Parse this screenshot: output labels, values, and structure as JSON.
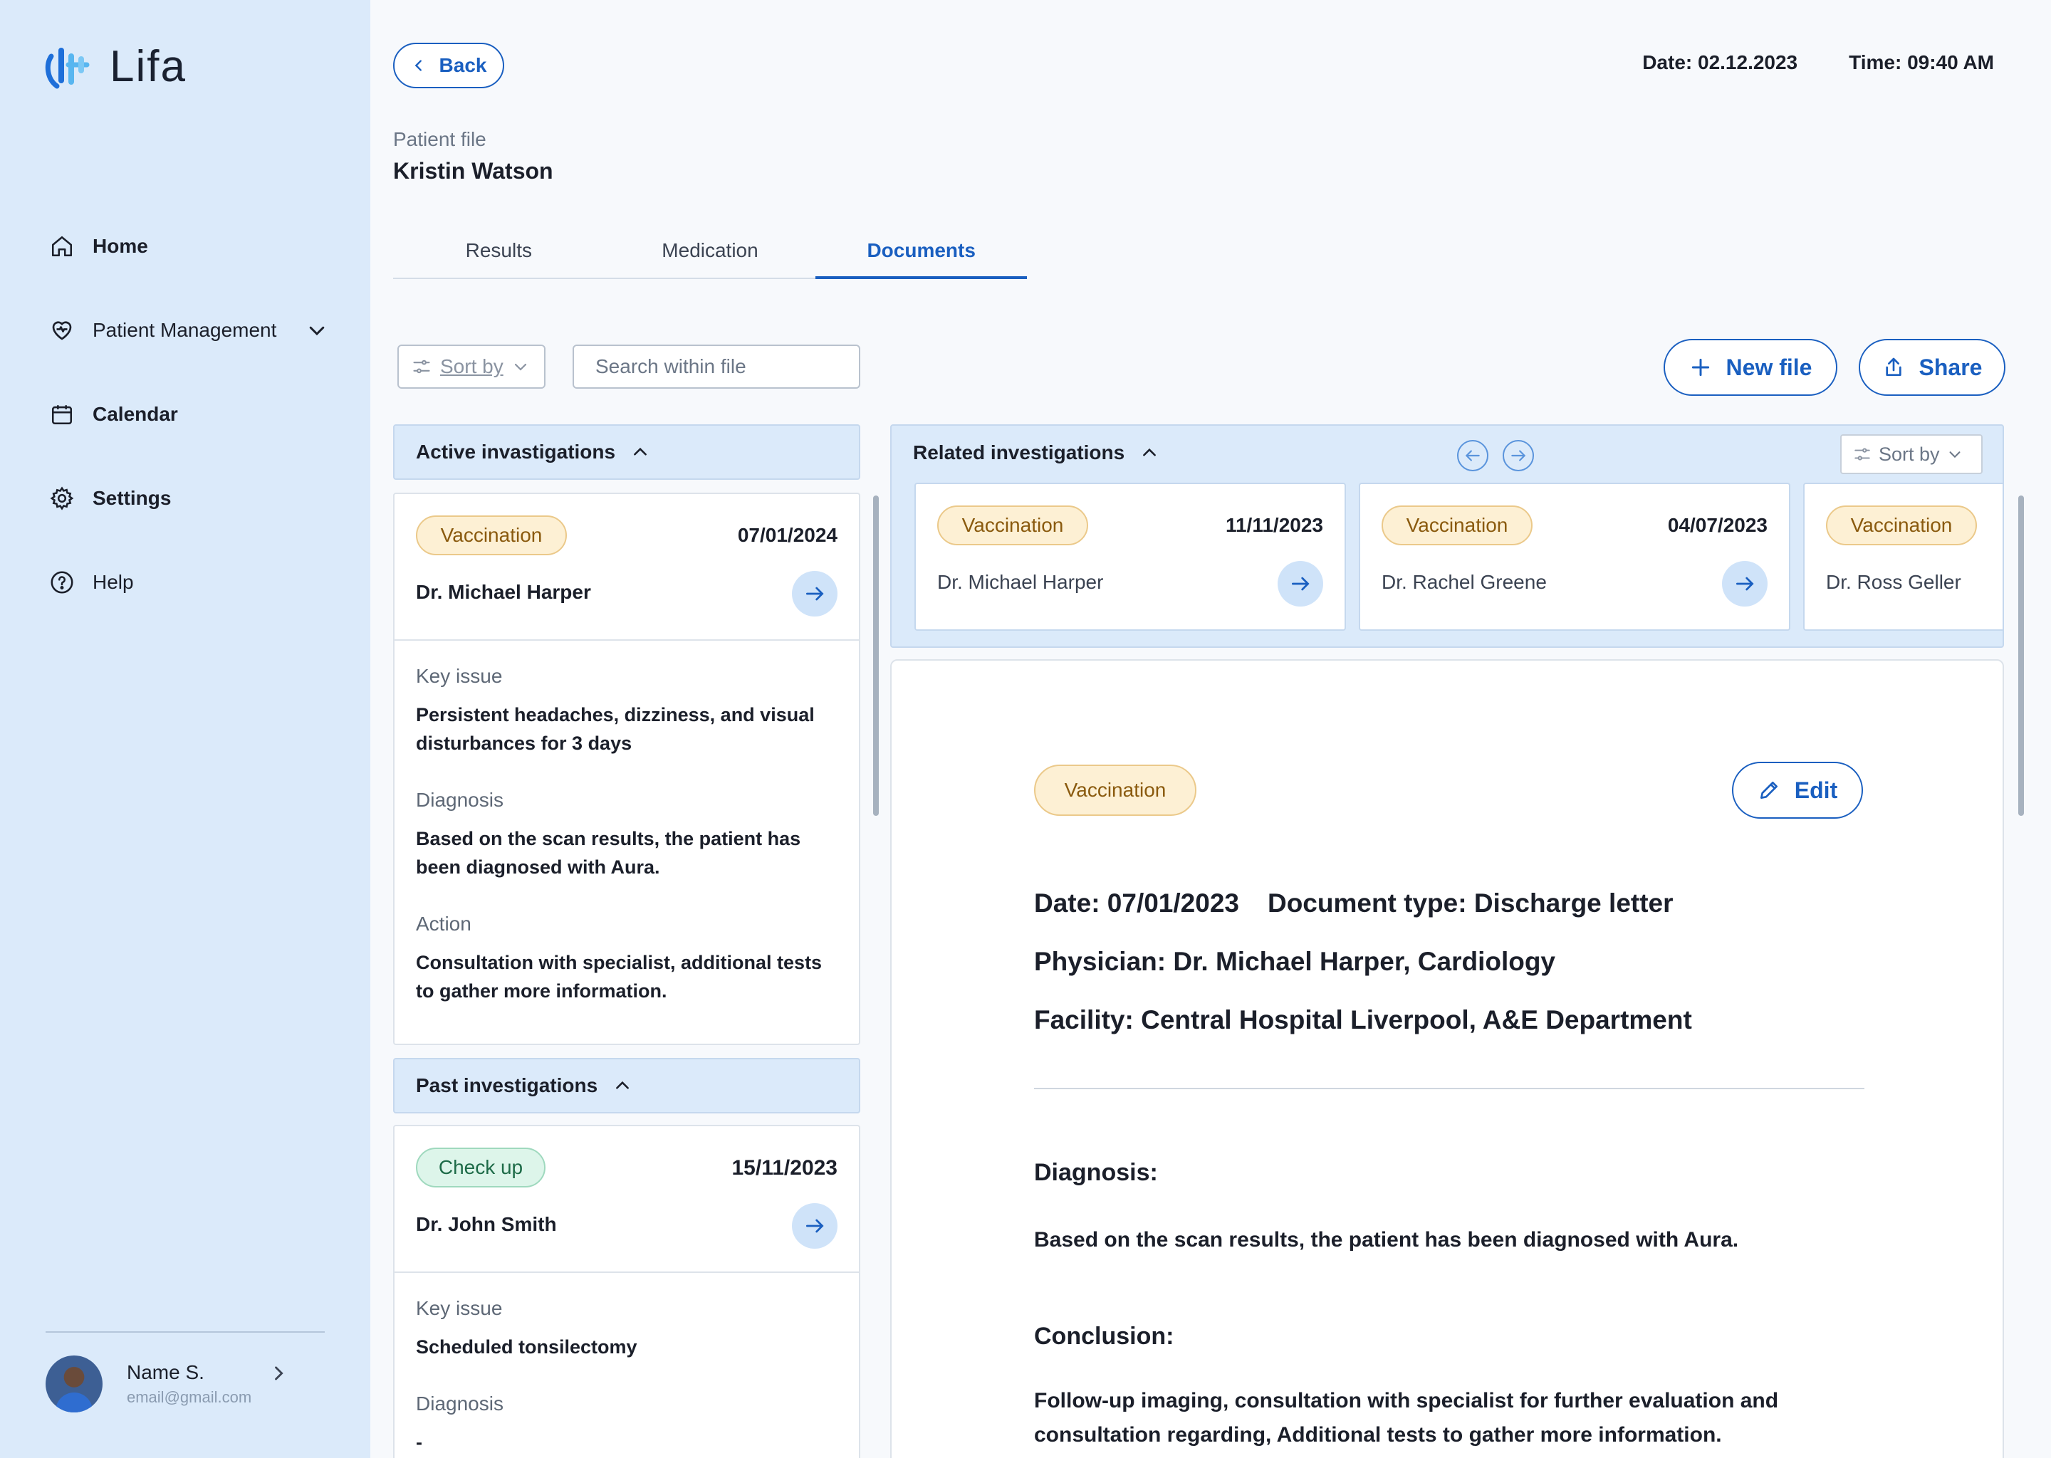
{
  "app": {
    "name": "Lifa"
  },
  "sidebar": {
    "items": [
      {
        "label": "Home",
        "icon": "home-icon"
      },
      {
        "label": "Patient Management",
        "icon": "heart-icon"
      },
      {
        "label": "Calendar",
        "icon": "calendar-icon"
      },
      {
        "label": "Settings",
        "icon": "gear-icon"
      },
      {
        "label": "Help",
        "icon": "help-icon"
      }
    ],
    "profile": {
      "name": "Name S.",
      "email": "email@gmail.com"
    }
  },
  "header": {
    "back_label": "Back",
    "date": "Date: 02.12.2023",
    "time": "Time: 09:40 AM",
    "patient_file_label": "Patient file",
    "patient_name": "Kristin Watson"
  },
  "tabs": [
    {
      "label": "Results",
      "active": false
    },
    {
      "label": "Medication",
      "active": false
    },
    {
      "label": "Documents",
      "active": true
    }
  ],
  "toolbar": {
    "sort_label": "Sort by",
    "search_placeholder": "Search within file",
    "new_file_label": "New file",
    "share_label": "Share"
  },
  "active_investigations": {
    "title": "Active invastigations",
    "card": {
      "badge": "Vaccination",
      "date": "07/01/2024",
      "doctor": "Dr. Michael Harper",
      "key_issue_label": "Key issue",
      "key_issue": "Persistent headaches, dizziness, and visual disturbances for 3 days",
      "diagnosis_label": "Diagnosis",
      "diagnosis": "Based on the scan results, the patient has been diagnosed with Aura.",
      "action_label": "Action",
      "action": "Consultation with specialist, additional tests to gather more information."
    }
  },
  "past_investigations": {
    "title": "Past investigations",
    "card": {
      "badge": "Check up",
      "date": "15/11/2023",
      "doctor": "Dr. John Smith",
      "key_issue_label": "Key issue",
      "key_issue": "Scheduled tonsilectomy",
      "diagnosis_label": "Diagnosis",
      "diagnosis": "-"
    }
  },
  "related": {
    "title": "Related investigations",
    "sort_label": "Sort by",
    "cards": [
      {
        "badge": "Vaccination",
        "date": "11/11/2023",
        "doctor": "Dr. Michael Harper"
      },
      {
        "badge": "Vaccination",
        "date": "04/07/2023",
        "doctor": "Dr. Rachel Greene"
      },
      {
        "badge": "Vaccination",
        "date": "",
        "doctor": "Dr. Ross Geller"
      }
    ]
  },
  "document": {
    "badge": "Vaccination",
    "edit_label": "Edit",
    "date": "Date: 07/01/2023",
    "doc_type": "Document type: Discharge letter",
    "physician": "Physician: Dr. Michael Harper, Cardiology",
    "facility": "Facility: Central Hospital Liverpool, A&E Department",
    "diagnosis_heading": "Diagnosis:",
    "diagnosis_text": "Based on the scan results, the patient has been diagnosed with Aura.",
    "conclusion_heading": "Conclusion:",
    "conclusion_text": "Follow-up imaging, consultation with specialist for further evaluation and consultation regarding, Additional tests to gather more information."
  },
  "colors": {
    "accent": "#1a5fc0",
    "sidebar_bg": "#dbeafa",
    "vaccination_badge": "#fdf0d4",
    "checkup_badge": "#ddf5ea"
  }
}
